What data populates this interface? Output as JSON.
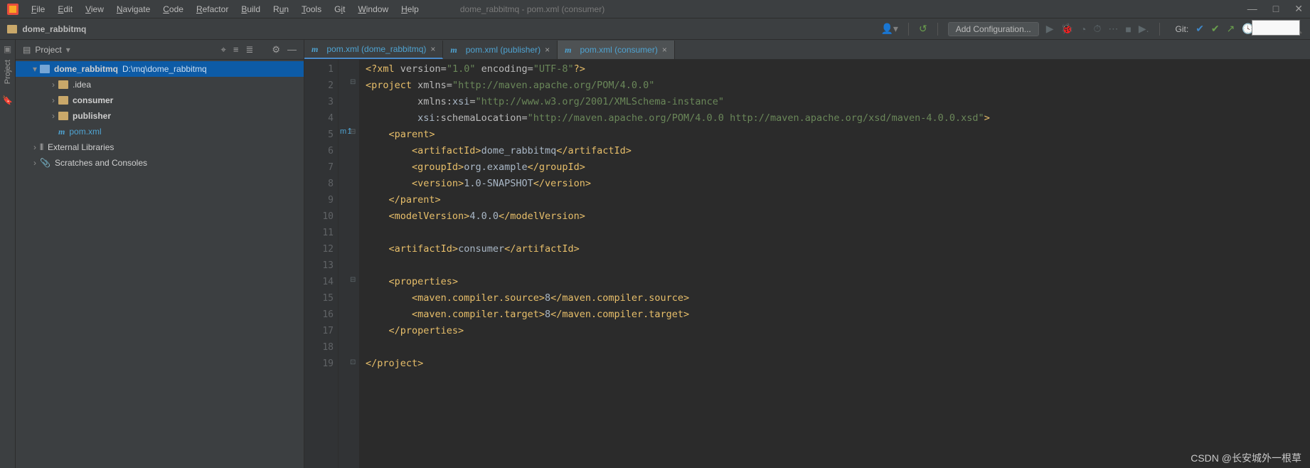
{
  "window": {
    "title": "dome_rabbitmq - pom.xml (consumer)"
  },
  "menu": [
    "File",
    "Edit",
    "View",
    "Navigate",
    "Code",
    "Refactor",
    "Build",
    "Run",
    "Tools",
    "Git",
    "Window",
    "Help"
  ],
  "breadcrumb": {
    "project": "dome_rabbitmq"
  },
  "toolbar": {
    "add_config": "Add Configuration...",
    "git_label": "Git:"
  },
  "rail": {
    "project_label": "Project"
  },
  "panel": {
    "title": "Project"
  },
  "tree": {
    "root": {
      "label": "dome_rabbitmq",
      "path": "D:\\mq\\dome_rabbitmq"
    },
    "idea": {
      "label": ".idea"
    },
    "consumer": {
      "label": "consumer"
    },
    "publisher": {
      "label": "publisher"
    },
    "pom": {
      "label": "pom.xml"
    },
    "ext": {
      "label": "External Libraries"
    },
    "scratch": {
      "label": "Scratches and Consoles"
    }
  },
  "tabs": [
    {
      "label": "pom.xml (dome_rabbitmq)"
    },
    {
      "label": "pom.xml (publisher)"
    },
    {
      "label": "pom.xml (consumer)"
    }
  ],
  "code": {
    "lines": 19,
    "xml_decl": "<?xml version=\"1.0\" encoding=\"UTF-8\"?>",
    "project_ns": "http://maven.apache.org/POM/4.0.0",
    "xsi_ns": "http://www.w3.org/2001/XMLSchema-instance",
    "schema_loc": "http://maven.apache.org/POM/4.0.0 http://maven.apache.org/xsd/maven-4.0.0.xsd",
    "parent_artifact": "dome_rabbitmq",
    "parent_group": "org.example",
    "parent_version": "1.0-SNAPSHOT",
    "model_version": "4.0.0",
    "artifact": "consumer",
    "compiler_source": "8",
    "compiler_target": "8"
  },
  "watermark": "CSDN @长安城外一根草"
}
